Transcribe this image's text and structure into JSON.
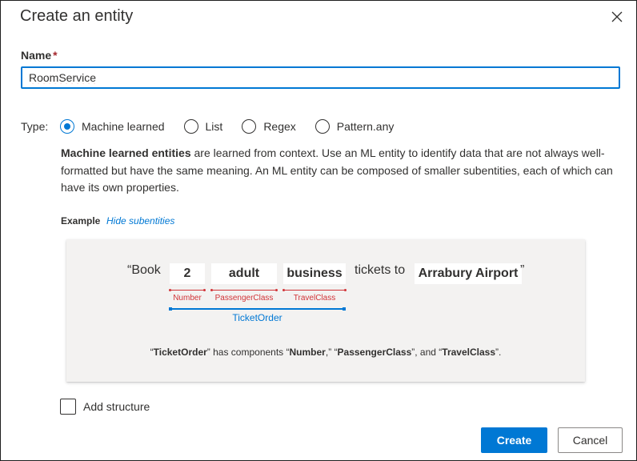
{
  "dialog": {
    "title": "Create an entity",
    "close_icon": "close-icon"
  },
  "name_field": {
    "label": "Name",
    "required_marker": "*",
    "value": "RoomService"
  },
  "type": {
    "label": "Type:",
    "options": [
      {
        "label": "Machine learned",
        "checked": true
      },
      {
        "label": "List",
        "checked": false
      },
      {
        "label": "Regex",
        "checked": false
      },
      {
        "label": "Pattern.any",
        "checked": false
      }
    ]
  },
  "description": {
    "bold_lead": "Machine learned entities",
    "rest": " are learned from context. Use an ML entity to identify data that are not always well-formatted but have the same meaning. An ML entity can be composed of smaller subentities, each of which can have its own properties."
  },
  "example": {
    "label": "Example",
    "hide_link": "Hide subentities",
    "open_quote": "“Book",
    "tokens": [
      "2",
      "adult",
      "business"
    ],
    "middle_text": "tickets to",
    "destination": "Arrabury Airport",
    "close_quote": "”",
    "subentity_labels": [
      "Number",
      "PassengerClass",
      "TravelClass"
    ],
    "parent_label": "TicketOrder",
    "caption": {
      "q1": "“",
      "parent": "TicketOrder",
      "q2": "” has components “",
      "c1": "Number",
      "q3": ",” “",
      "c2": "PassengerClass",
      "q4": "”, and “",
      "c3": "TravelClass",
      "q5": "”."
    }
  },
  "add_structure": {
    "label": "Add structure",
    "checked": false
  },
  "buttons": {
    "create": "Create",
    "cancel": "Cancel"
  },
  "colors": {
    "accent": "#0078d4",
    "entity": "#d13438"
  }
}
